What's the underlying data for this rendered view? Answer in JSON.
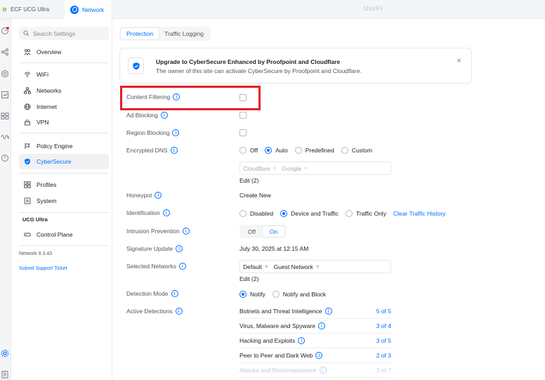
{
  "top_bar": {
    "site_tab": "ECF UCG Ultra",
    "network_tab": "Network",
    "brand": "UniFi"
  },
  "rail_icons": [
    "dashboard-icon",
    "topology-icon",
    "clients-icon",
    "statistics-icon",
    "users-icon",
    "radio-icon",
    "shield-icon",
    "settings-icon",
    "notes-icon"
  ],
  "sidebar": {
    "search_placeholder": "Search Settings",
    "items": [
      {
        "label": "Overview",
        "icon": "overview-icon"
      },
      {
        "label": "WiFi",
        "icon": "wifi-icon"
      },
      {
        "label": "Networks",
        "icon": "networks-icon"
      },
      {
        "label": "Internet",
        "icon": "globe-icon"
      },
      {
        "label": "VPN",
        "icon": "vpn-icon"
      },
      {
        "label": "Policy Engine",
        "icon": "policy-icon"
      },
      {
        "label": "CyberSecure",
        "icon": "shield-icon",
        "active": true
      },
      {
        "label": "Profiles",
        "icon": "profiles-icon"
      },
      {
        "label": "System",
        "icon": "system-icon"
      }
    ],
    "device_header": "UCG Ultra",
    "device_item": "Control Plane",
    "version": "Network 9.3.43",
    "support_link": "Submit Support Ticket"
  },
  "main": {
    "tabs": [
      {
        "label": "Protection",
        "active": true
      },
      {
        "label": "Traffic Logging",
        "active": false
      }
    ],
    "banner": {
      "title": "Upgrade to CyberSecure Enhanced by Proofpoint and Cloudflare",
      "subtitle": "The owner of this site can activate CyberSecure by Proofpoint and Cloudflare.",
      "close": "×"
    },
    "content_filtering": {
      "label": "Content Filtering",
      "checked": false
    },
    "ad_blocking": {
      "label": "Ad Blocking",
      "checked": false
    },
    "region_blocking": {
      "label": "Region Blocking",
      "checked": false
    },
    "encrypted_dns": {
      "label": "Encrypted DNS",
      "options": [
        "Off",
        "Auto",
        "Predefined",
        "Custom"
      ],
      "selected": "Auto",
      "servers": [
        "Cloudflare",
        "Google"
      ],
      "edit": "Edit (2)"
    },
    "honeypot": {
      "label": "Honeypot",
      "action": "Create New"
    },
    "identification": {
      "label": "Identification",
      "options": [
        "Disabled",
        "Device and Traffic",
        "Traffic Only"
      ],
      "selected": "Device and Traffic",
      "clear_link": "Clear Traffic History"
    },
    "intrusion_prevention": {
      "label": "Intrusion Prevention",
      "options": [
        "Off",
        "On"
      ],
      "selected": "On"
    },
    "signature_update": {
      "label": "Signature Update",
      "value": "July 30, 2025 at 12:15 AM"
    },
    "selected_networks": {
      "label": "Selected Networks",
      "networks": [
        "Default",
        "Guest Network"
      ],
      "edit": "Edit (2)"
    },
    "detection_mode": {
      "label": "Detection Mode",
      "options": [
        "Notify",
        "Notify and Block"
      ],
      "selected": "Notify"
    },
    "active_detections": {
      "label": "Active Detections",
      "rows": [
        {
          "name": "Botnets and Threat Intelligence",
          "count": "5 of 5"
        },
        {
          "name": "Virus, Malware and Spyware",
          "count": "3 of 4"
        },
        {
          "name": "Hacking and Exploits",
          "count": "3 of 5"
        },
        {
          "name": "Peer to Peer and Dark Web",
          "count": "2 of 3"
        },
        {
          "name": "Attacks and Reconnaissance",
          "count": "3 of 7"
        }
      ]
    },
    "highlight_color": "#e41e26",
    "accent_color": "#006fff"
  }
}
